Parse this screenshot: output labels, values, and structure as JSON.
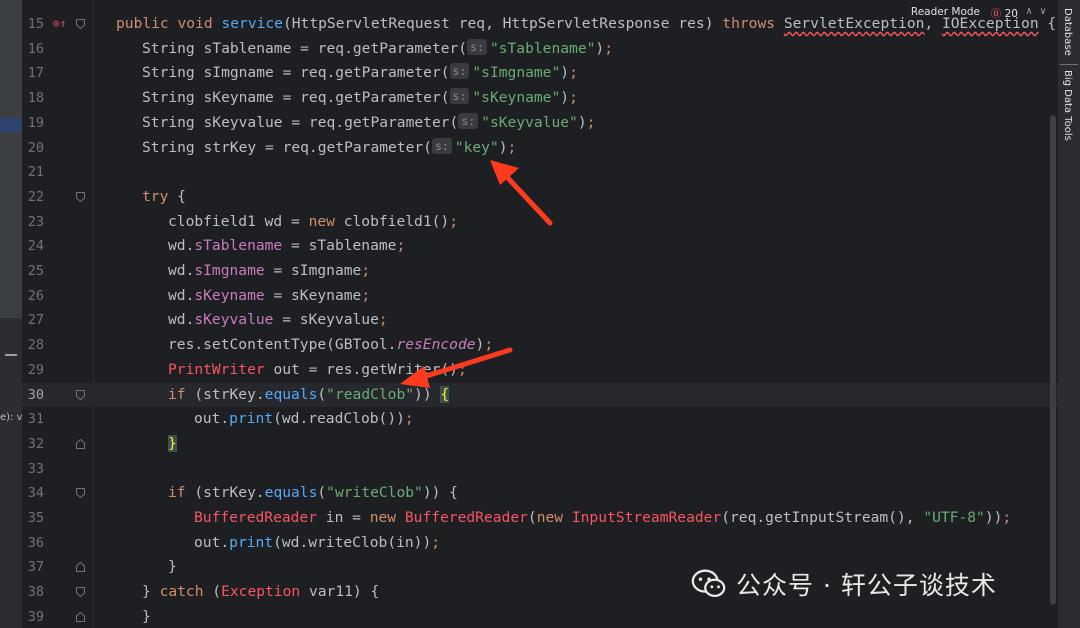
{
  "toolbar": {
    "reader_mode_label": "Reader Mode",
    "error_count": "20",
    "error_icon": "error-circle-icon"
  },
  "left_strip": {
    "text": "e): v"
  },
  "right_bar": {
    "tabs": [
      "Database",
      "Big Data Tools"
    ]
  },
  "watermark": {
    "text": "公众号 · 轩公子谈技术",
    "icon": "wechat-icon"
  },
  "colors": {
    "keyword": "#cf8e6d",
    "string": "#6aab73",
    "method": "#56a8f5",
    "field": "#c77dbb",
    "error": "#f75464",
    "arrow": "#ff3b1f"
  },
  "code": {
    "current_line": 30,
    "lines": [
      {
        "n": "15",
        "t": "public void service(HttpServletRequest req, HttpServletResponse res) throws ServletException, IOException {"
      },
      {
        "n": "16",
        "t": "String sTablename = req.getParameter(s: \"sTablename\");"
      },
      {
        "n": "17",
        "t": "String sImgname = req.getParameter(s: \"sImgname\");"
      },
      {
        "n": "18",
        "t": "String sKeyname = req.getParameter(s: \"sKeyname\");"
      },
      {
        "n": "19",
        "t": "String sKeyvalue = req.getParameter(s: \"sKeyvalue\");"
      },
      {
        "n": "20",
        "t": "String strKey = req.getParameter(s: \"key\");"
      },
      {
        "n": "21",
        "t": ""
      },
      {
        "n": "22",
        "t": "try {"
      },
      {
        "n": "23",
        "t": "clobfield1 wd = new clobfield1();"
      },
      {
        "n": "24",
        "t": "wd.sTablename = sTablename;"
      },
      {
        "n": "25",
        "t": "wd.sImgname = sImgname;"
      },
      {
        "n": "26",
        "t": "wd.sKeyname = sKeyname;"
      },
      {
        "n": "27",
        "t": "wd.sKeyvalue = sKeyvalue;"
      },
      {
        "n": "28",
        "t": "res.setContentType(GBTool.resEncode);"
      },
      {
        "n": "29",
        "t": "PrintWriter out = res.getWriter();"
      },
      {
        "n": "30",
        "t": "if (strKey.equals(\"readClob\")) {"
      },
      {
        "n": "31",
        "t": "out.print(wd.readClob());"
      },
      {
        "n": "32",
        "t": "}"
      },
      {
        "n": "33",
        "t": ""
      },
      {
        "n": "34",
        "t": "if (strKey.equals(\"writeClob\")) {"
      },
      {
        "n": "35",
        "t": "BufferedReader in = new BufferedReader(new InputStreamReader(req.getInputStream(), \"UTF-8\"));"
      },
      {
        "n": "36",
        "t": "out.print(wd.writeClob(in));"
      },
      {
        "n": "37",
        "t": "}"
      },
      {
        "n": "38",
        "t": "} catch (Exception var11) {"
      },
      {
        "n": "39",
        "t": "}"
      }
    ]
  }
}
